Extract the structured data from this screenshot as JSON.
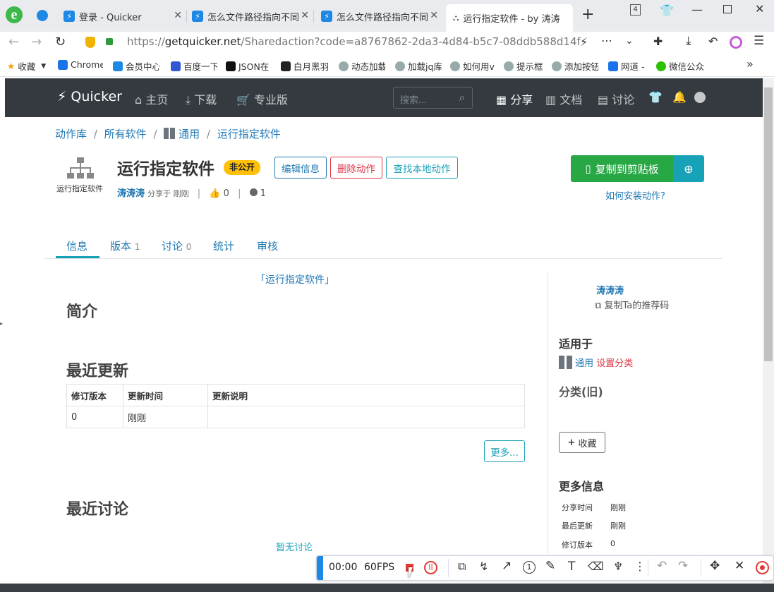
{
  "browser": {
    "tabs": [
      {
        "title": "登录 - Quicker"
      },
      {
        "title": "怎么文件路径指向不同"
      },
      {
        "title": "怎么文件路径指向不同"
      },
      {
        "title": "运行指定软件 - by 涛涛"
      }
    ],
    "tab_count": "4",
    "new_tab": "+",
    "url_prefix": "https://",
    "url_host": "getquicker.net",
    "url_path": "/Sharedaction?code=a8767862-2da3-4d84-b5c7-08ddb588d14f",
    "bookmarks": [
      "收藏",
      "Chrome",
      "会员中心",
      "百度一下",
      "JSON在",
      "白月黑羽",
      "动态加载",
      "加载jq库",
      "如何用v",
      "提示框",
      "添加按钮",
      "网道 -",
      "微信公众"
    ],
    "bookmarks_more": "»"
  },
  "nav": {
    "brand": "Quicker",
    "home": "主页",
    "download": "下载",
    "pro": "专业版",
    "search_placeholder": "搜索...",
    "share": "分享",
    "docs": "文档",
    "discuss": "讨论"
  },
  "breadcrumb": [
    "动作库",
    "所有软件",
    "通用",
    "运行指定软件"
  ],
  "action": {
    "icon_label": "运行指定软件",
    "title": "运行指定软件",
    "badge": "非公开",
    "edit_btn": "编辑信息",
    "delete_btn": "删除动作",
    "find_btn": "查找本地动作",
    "author": "涛涛涛",
    "shared": "分享于 刚刚",
    "likes": "0",
    "users": "1",
    "copy_btn": "复制到剪贴板",
    "install_help": "如何安装动作?"
  },
  "tabs": [
    {
      "label": "信息",
      "count": ""
    },
    {
      "label": "版本",
      "count": "1"
    },
    {
      "label": "讨论",
      "count": "0"
    },
    {
      "label": "统计",
      "count": ""
    },
    {
      "label": "审核",
      "count": ""
    }
  ],
  "main": {
    "quote_title": "「运行指定软件」",
    "intro_heading": "简介",
    "updates_heading": "最近更新",
    "table_headers": [
      "修订版本",
      "更新时间",
      "更新说明"
    ],
    "table_rows": [
      [
        "0",
        "刚刚",
        ""
      ]
    ],
    "more_btn": "更多...",
    "discuss_heading": "最近讨论",
    "no_discuss": "暂无讨论"
  },
  "sidebar": {
    "author": "涛涛涛",
    "copy_ref": "复制Ta的推荐码",
    "applies_heading": "适用于",
    "applies_value": "通用",
    "set_category": "设置分类",
    "category_old": "分类(旧)",
    "favorite_btn": "收藏",
    "more_info_heading": "更多信息",
    "info": [
      {
        "k": "分享时间",
        "v": "刚刚"
      },
      {
        "k": "最后更新",
        "v": "刚刚"
      },
      {
        "k": "修订版本",
        "v": "0"
      }
    ]
  },
  "recorder": {
    "time": "00:00",
    "fps": "60FPS"
  },
  "colors": {
    "navbar": "#343a40",
    "link": "#1f78b4",
    "teal": "#17a2b8",
    "green": "#28a745",
    "danger": "#dc3545",
    "badge": "#ffc107"
  }
}
